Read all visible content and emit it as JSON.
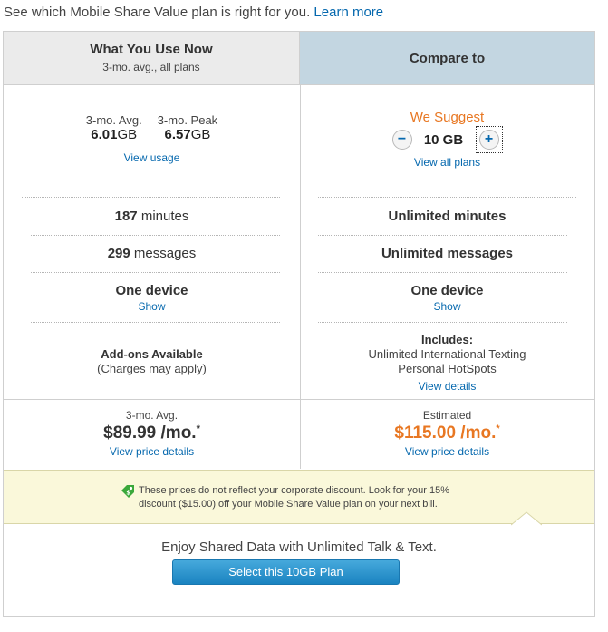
{
  "intro": {
    "text": "See which Mobile Share Value plan is right for you.",
    "link": "Learn more"
  },
  "left": {
    "title": "What You Use Now",
    "subtitle": "3-mo. avg., all plans",
    "avg_label": "3-mo. Avg.",
    "avg_value": "6.01",
    "avg_unit": "GB",
    "peak_label": "3-mo. Peak",
    "peak_value": "6.57",
    "peak_unit": "GB",
    "view_usage": "View usage",
    "minutes_value": "187",
    "minutes_label": "minutes",
    "messages_value": "299",
    "messages_label": "messages",
    "device": "One device",
    "device_link": "Show",
    "addons_title": "Add-ons Available",
    "addons_sub": "(Charges may apply)",
    "price_caption": "3-mo. Avg.",
    "price": "$89.99 /mo.",
    "price_mark": "*",
    "price_link": "View price details"
  },
  "right": {
    "title": "Compare to",
    "suggest": "We Suggest",
    "plan_value": "10 GB",
    "minus": "−",
    "plus": "+",
    "view_all": "View all plans",
    "minutes": "Unlimited minutes",
    "messages": "Unlimited messages",
    "device": "One device",
    "device_link": "Show",
    "includes_title": "Includes:",
    "include_1": "Unlimited International Texting",
    "include_2": "Personal HotSpots",
    "details_link": "View details",
    "price_caption": "Estimated",
    "price": "$115.00 /mo.",
    "price_mark": "*",
    "price_link": "View price details"
  },
  "notice": {
    "line1": "These prices do not reflect your corporate discount. Look for your 15%",
    "line2": "discount ($15.00) off your Mobile Share Value plan on your next bill."
  },
  "footer": {
    "enjoy": "Enjoy Shared Data with Unlimited Talk & Text.",
    "cta": "Select this 10GB Plan"
  },
  "colors": {
    "link": "#0568ae",
    "accent": "#e87722",
    "header_left": "#ebebeb",
    "header_right": "#c3d6e1",
    "notice_bg": "#faf8da",
    "tag_icon": "#3aa83a"
  },
  "icons": {
    "tag": "price-tag-icon"
  }
}
